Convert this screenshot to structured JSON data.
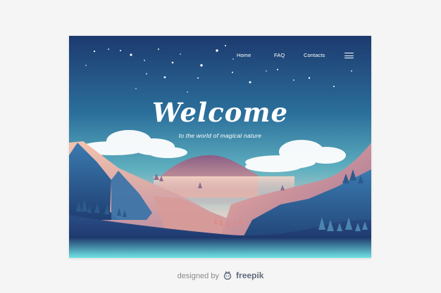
{
  "nav": {
    "items": [
      {
        "label": "Home"
      },
      {
        "label": "FAQ"
      },
      {
        "label": "Contacts"
      }
    ],
    "menu_icon": "hamburger-menu-icon"
  },
  "hero": {
    "title": "Welcome",
    "subtitle": "to the world of magical nature"
  },
  "footer": {
    "credit_prefix": "designed by",
    "brand": "freepik",
    "brand_icon": "freepik-logo-icon"
  },
  "colors": {
    "sky_top": "#1e3f74",
    "sky_mid": "#2f8fa8",
    "horizon": "#e9d2c4",
    "mountain_peach": "#f0b7a4",
    "mountain_blue": "#2c5c8f",
    "ground": "#1e3a6e",
    "foreground_glow": "#6ee6e4"
  }
}
